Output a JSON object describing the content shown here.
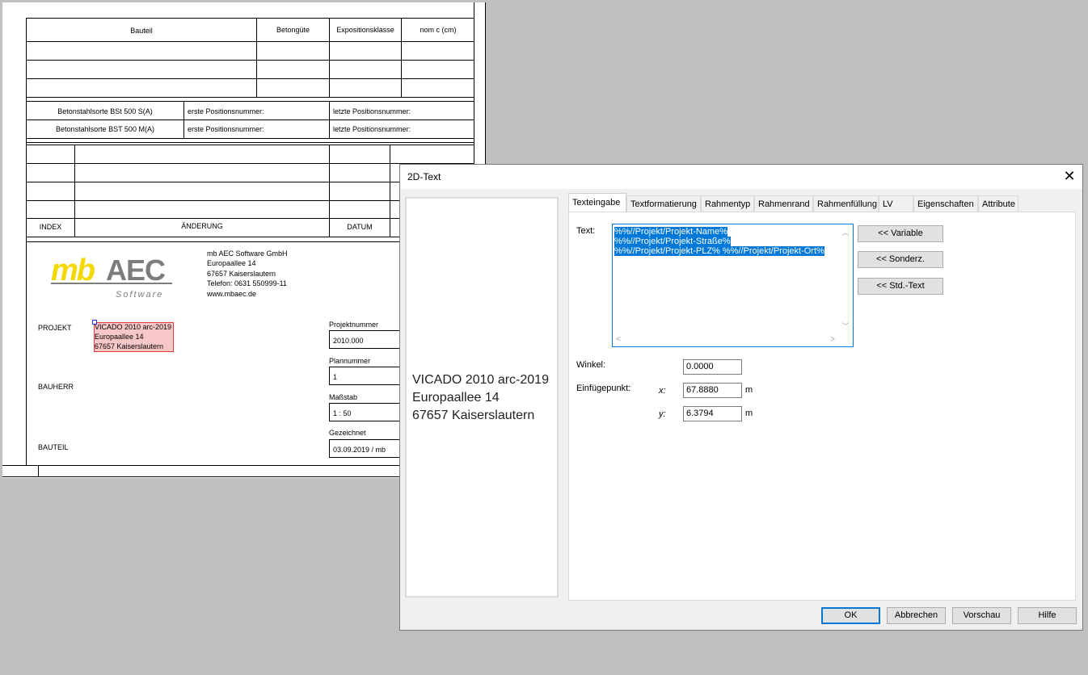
{
  "sheet": {
    "header": {
      "bauteil": "Bauteil",
      "betonguete": "Betongüte",
      "expositionsklasse": "Expositionsklasse",
      "nom_c": "nom c (cm)"
    },
    "steel_rows": [
      {
        "label": "Betonstahlsorte BSt 500 S(A)",
        "first": "erste Positionsnummer:",
        "last": "letzte Positionsnummer:"
      },
      {
        "label": "Betonstahlsorte BST 500 M(A)",
        "first": "erste Positionsnummer:",
        "last": "letzte Positionsnummer:"
      }
    ],
    "revision_footer": {
      "index": "INDEX",
      "aenderung": "ÄNDERUNG",
      "datum": "DATUM"
    },
    "logo": {
      "brand_main": "mbAEC",
      "brand_sub": "Software"
    },
    "company": [
      "mb AEC Software GmbH",
      "Europaallee 14",
      "67657 Kaiserslautern",
      "Telefon: 0631 550999-11",
      "www.mbaec.de"
    ],
    "labels": {
      "projekt": "PROJEKT",
      "bauherr": "BAUHERR",
      "bauteil": "BAUTEIL"
    },
    "project_text": [
      "VICADO 2010 arc-2019",
      "Europaallee 14",
      "67657 Kaiserslautern"
    ],
    "fields": {
      "projektnummer_label": "Projektnummer",
      "projektnummer": "2010.000",
      "plannummer_label": "Plannummer",
      "plannummer": "1",
      "massstab_label": "Maßstab",
      "massstab": "1 : 50",
      "gezeichnet_label": "Gezeichnet",
      "gezeichnet": "03.09.2019 / mb"
    }
  },
  "dialog": {
    "title": "2D-Text",
    "close": "✕",
    "preview_lines": [
      "VICADO 2010 arc-2019",
      "Europaallee 14",
      "67657 Kaiserslautern"
    ],
    "tabs": [
      "Texteingabe",
      "Textformatierung",
      "Rahmentyp",
      "Rahmenrand",
      "Rahmenfüllung",
      "LV",
      "Eigenschaften",
      "Attribute"
    ],
    "active_tab": "Texteingabe",
    "text_label": "Text:",
    "text_lines": [
      "%%//Projekt/Projekt-Name%",
      "%%//Projekt/Projekt-Straße%",
      "%%//Projekt/Projekt-PLZ% %%//Projekt/Projekt-Ort%"
    ],
    "buttons_side": {
      "variable": "<< Variable",
      "sonderz": "<< Sonderz.",
      "stdtext": "<< Std.-Text"
    },
    "winkel_label": "Winkel:",
    "winkel": "0.0000",
    "einfuege_label": "Einfügepunkt:",
    "x_label": "x:",
    "x": "67.8880",
    "y_label": "y:",
    "y": "6.3794",
    "unit": "m",
    "footer": {
      "ok": "OK",
      "abbrechen": "Abbrechen",
      "vorschau": "Vorschau",
      "hilfe": "Hilfe"
    }
  },
  "colors": {
    "accent": "#0078d7",
    "logo_yellow": "#f5d800",
    "logo_gray": "#7d7d7d",
    "highlight_fill": "#f7c6c6",
    "highlight_border": "#e03a3a"
  }
}
